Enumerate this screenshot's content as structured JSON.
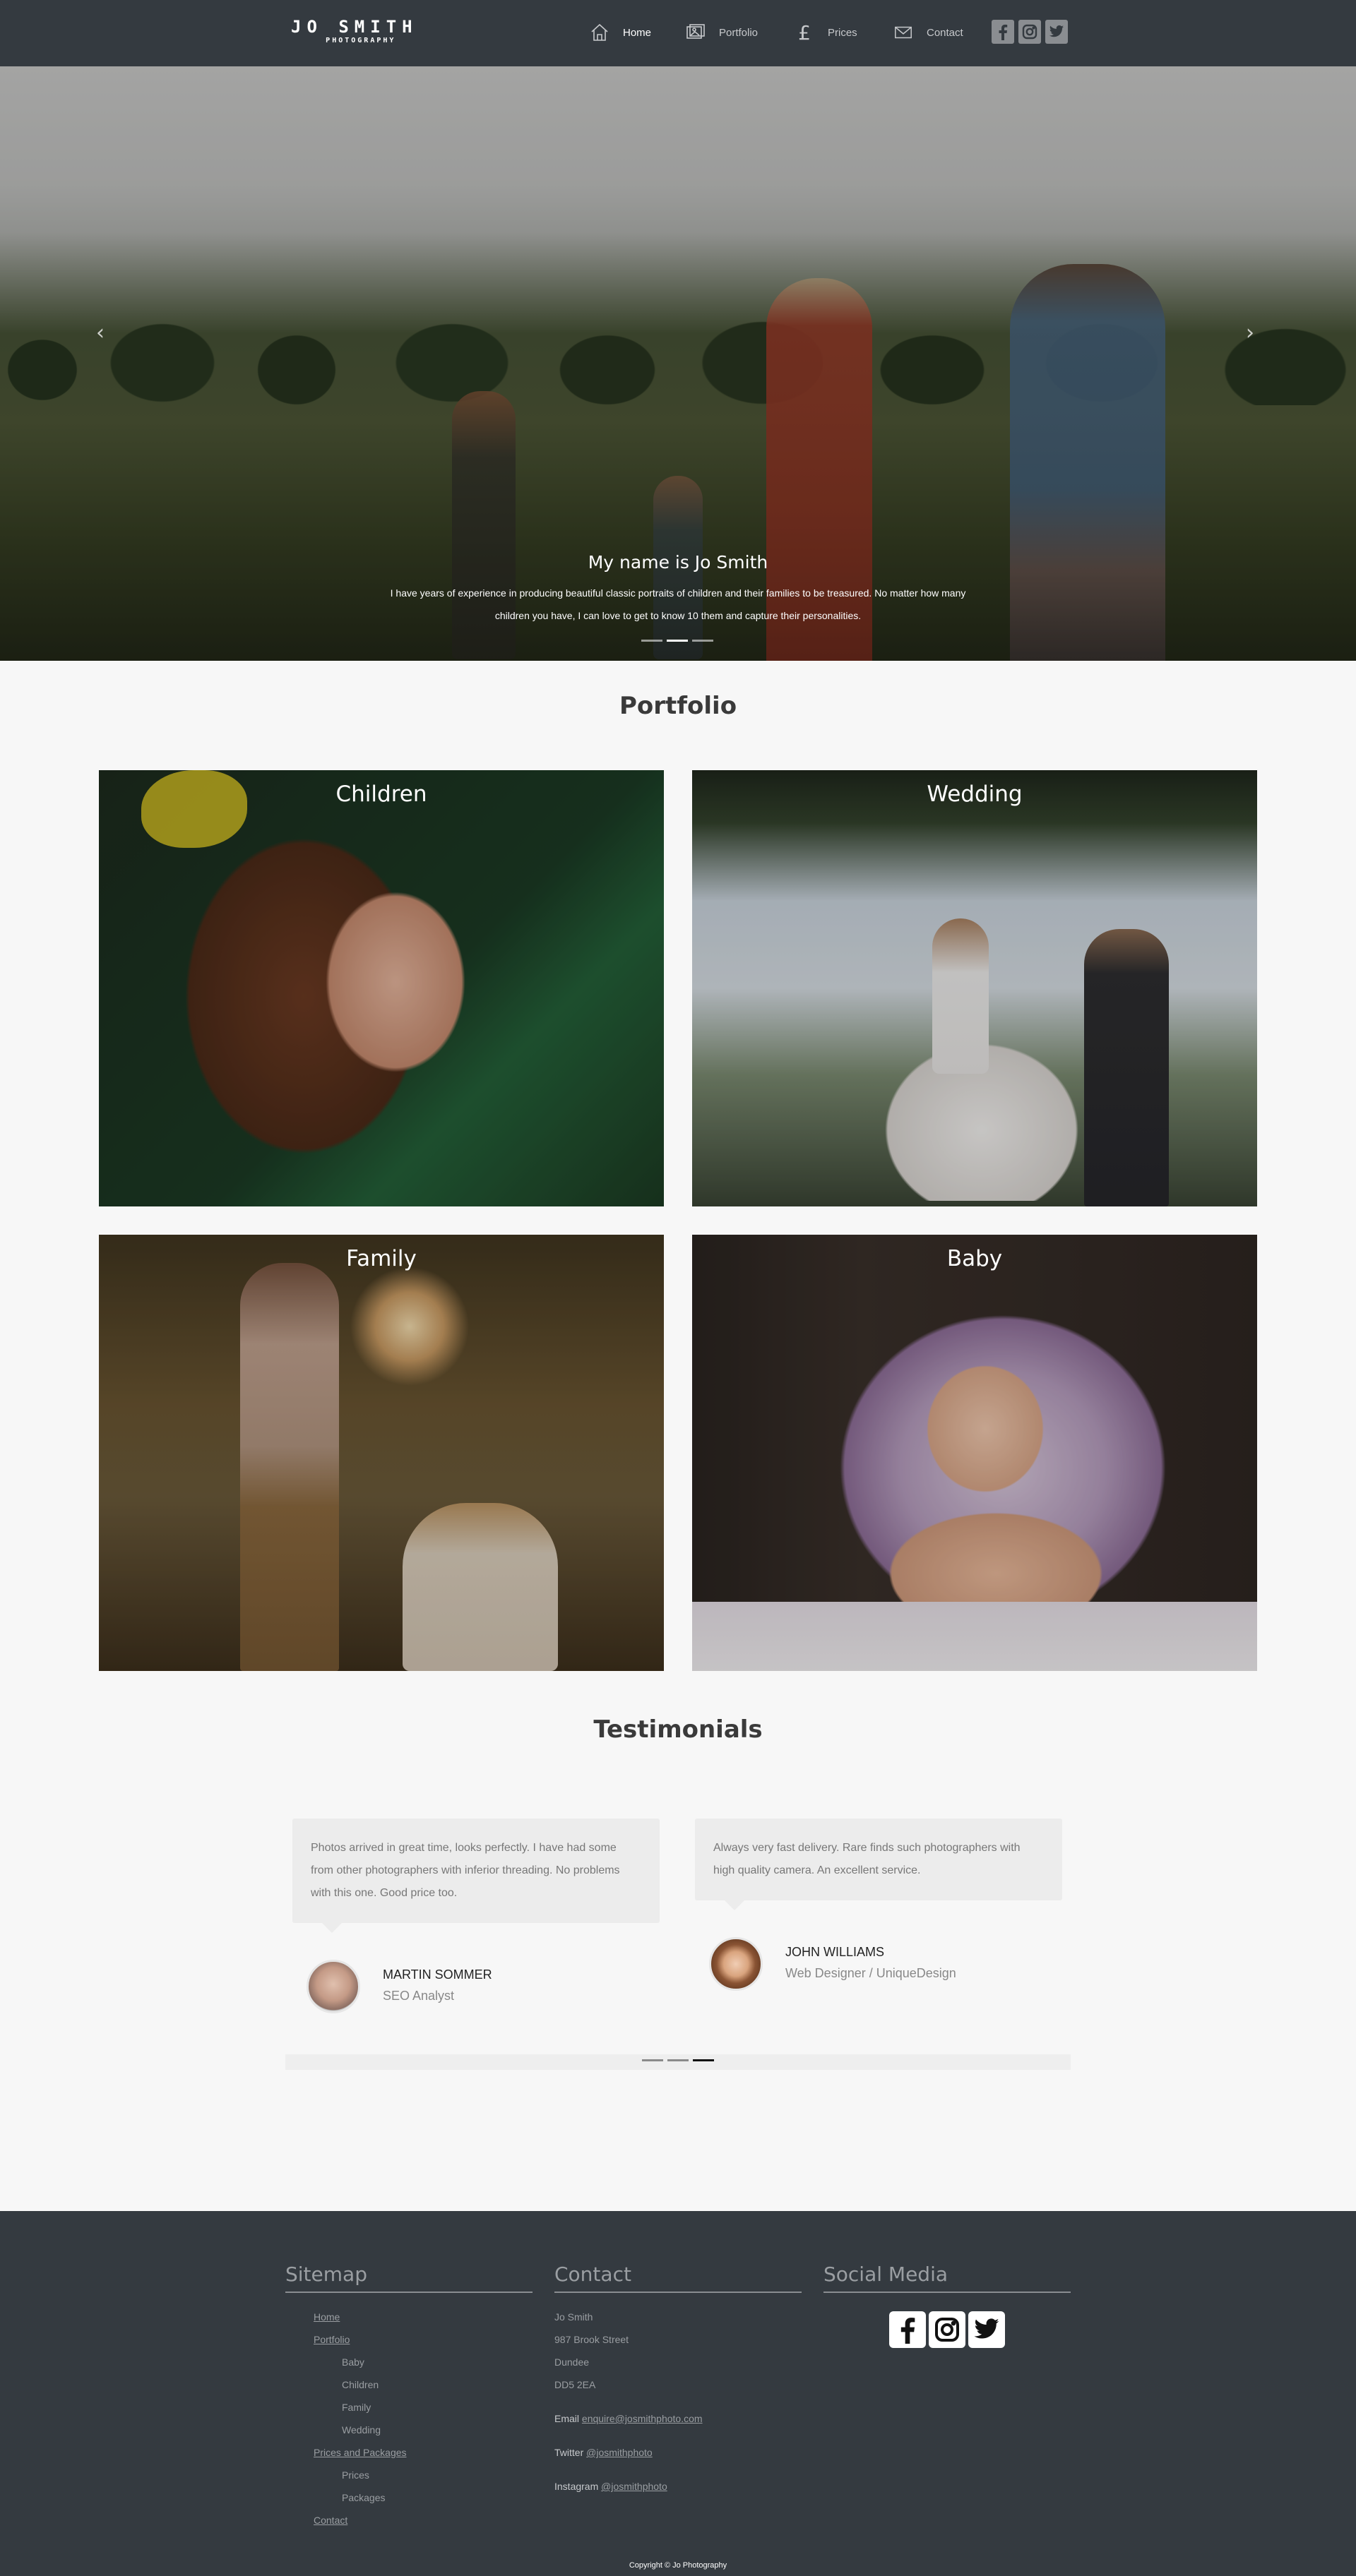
{
  "header": {
    "logo_line1": "JO SMITH",
    "logo_line2": "PHOTOGRAPHY",
    "nav": [
      {
        "label": "Home",
        "icon": "home-icon",
        "active": true
      },
      {
        "label": "Portfolio",
        "icon": "portfolio-icon",
        "active": false
      },
      {
        "label": "Prices",
        "icon": "pound-icon",
        "active": false
      },
      {
        "label": "Contact",
        "icon": "envelope-icon",
        "active": false
      }
    ],
    "social": [
      "facebook-icon",
      "instagram-icon",
      "twitter-icon"
    ]
  },
  "hero": {
    "title": "My name is Jo Smith",
    "text": "I have years of experience in producing beautiful classic portraits of children and their families to be treasured. No matter how many children you have, I can love to get to know 10 them and capture their personalities.",
    "prev_glyph": "‹",
    "next_glyph": "›",
    "slides": 3,
    "active_slide": 2
  },
  "portfolio": {
    "title": "Portfolio",
    "tiles": [
      "Children",
      "Wedding",
      "Family",
      "Baby"
    ]
  },
  "testimonials": {
    "title": "Testimonials",
    "items": [
      {
        "quote": "Photos arrived in great time, looks perfectly. I have had some from other photographers with inferior threading. No problems with this one. Good price too.",
        "name": "MARTIN SOMMER",
        "role": "SEO Analyst"
      },
      {
        "quote": "Always very fast delivery. Rare finds such photographers with high quality camera. An excellent service.",
        "name": "JOHN WILLIAMS",
        "role": "Web Designer / UniqueDesign"
      }
    ],
    "slides": 3,
    "active_slide": 3
  },
  "footer": {
    "sitemap_title": "Sitemap",
    "sitemap": {
      "home": "Home",
      "portfolio": "Portfolio",
      "baby": "Baby",
      "children": "Children",
      "family": "Family",
      "wedding": "Wedding",
      "prices_packages": "Prices and Packages",
      "prices": "Prices",
      "packages": "Packages",
      "contact": "Contact"
    },
    "contact_title": "Contact",
    "address": [
      "Jo Smith",
      "987 Brook Street",
      "Dundee",
      "DD5 2EA"
    ],
    "email_label": "Email",
    "email": "enquire@josmithphoto.com",
    "twitter_label": "Twitter",
    "twitter": "@josmithphoto",
    "instagram_label": "Instagram",
    "instagram": "@josmithphoto",
    "social_title": "Social Media",
    "copyright": "Copyright © Jo Photography"
  }
}
